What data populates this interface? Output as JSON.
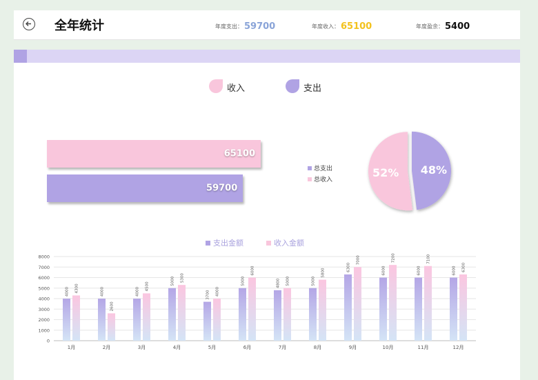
{
  "header": {
    "title": "全年统计",
    "stats": [
      {
        "label": "年度支出：",
        "value": "59700",
        "color": "#8aa4d8"
      },
      {
        "label": "年度收入：",
        "value": "65100",
        "color": "#f3c21d"
      },
      {
        "label": "年度盈余：",
        "value": "5400",
        "color": "#111111"
      }
    ]
  },
  "colors": {
    "income": "#f9c6dc",
    "expense": "#b0a3e4",
    "income_bar_top": "#fbc6e0",
    "expense_bar_top": "#b4a6e6",
    "bar_bottom": "#d4e4f6"
  },
  "legend_top": {
    "income": "收入",
    "expense": "支出"
  },
  "summary": {
    "income_value": "65100",
    "expense_value": "59700",
    "income": 65100,
    "expense": 59700,
    "pie": [
      {
        "label": "总支出",
        "percent_label": "48%",
        "value": 48
      },
      {
        "label": "总收入",
        "percent_label": "52%",
        "value": 52
      }
    ]
  },
  "chart_data": {
    "type": "bar",
    "categories": [
      "1月",
      "2月",
      "3月",
      "4月",
      "5月",
      "6月",
      "7月",
      "8月",
      "9月",
      "10月",
      "11月",
      "12月"
    ],
    "series": [
      {
        "name": "支出金额",
        "values": [
          4000,
          4000,
          4000,
          5000,
          3700,
          5000,
          4800,
          5000,
          6300,
          6000,
          6000,
          6000
        ]
      },
      {
        "name": "收入金额",
        "values": [
          4300,
          2600,
          4500,
          5300,
          4000,
          6000,
          5000,
          5800,
          7000,
          7200,
          7100,
          6300
        ]
      }
    ],
    "ylim": [
      0,
      8000
    ],
    "yticks": [
      0,
      1000,
      2000,
      3000,
      4000,
      5000,
      6000,
      7000,
      8000
    ],
    "grid": true,
    "legend": "top"
  }
}
